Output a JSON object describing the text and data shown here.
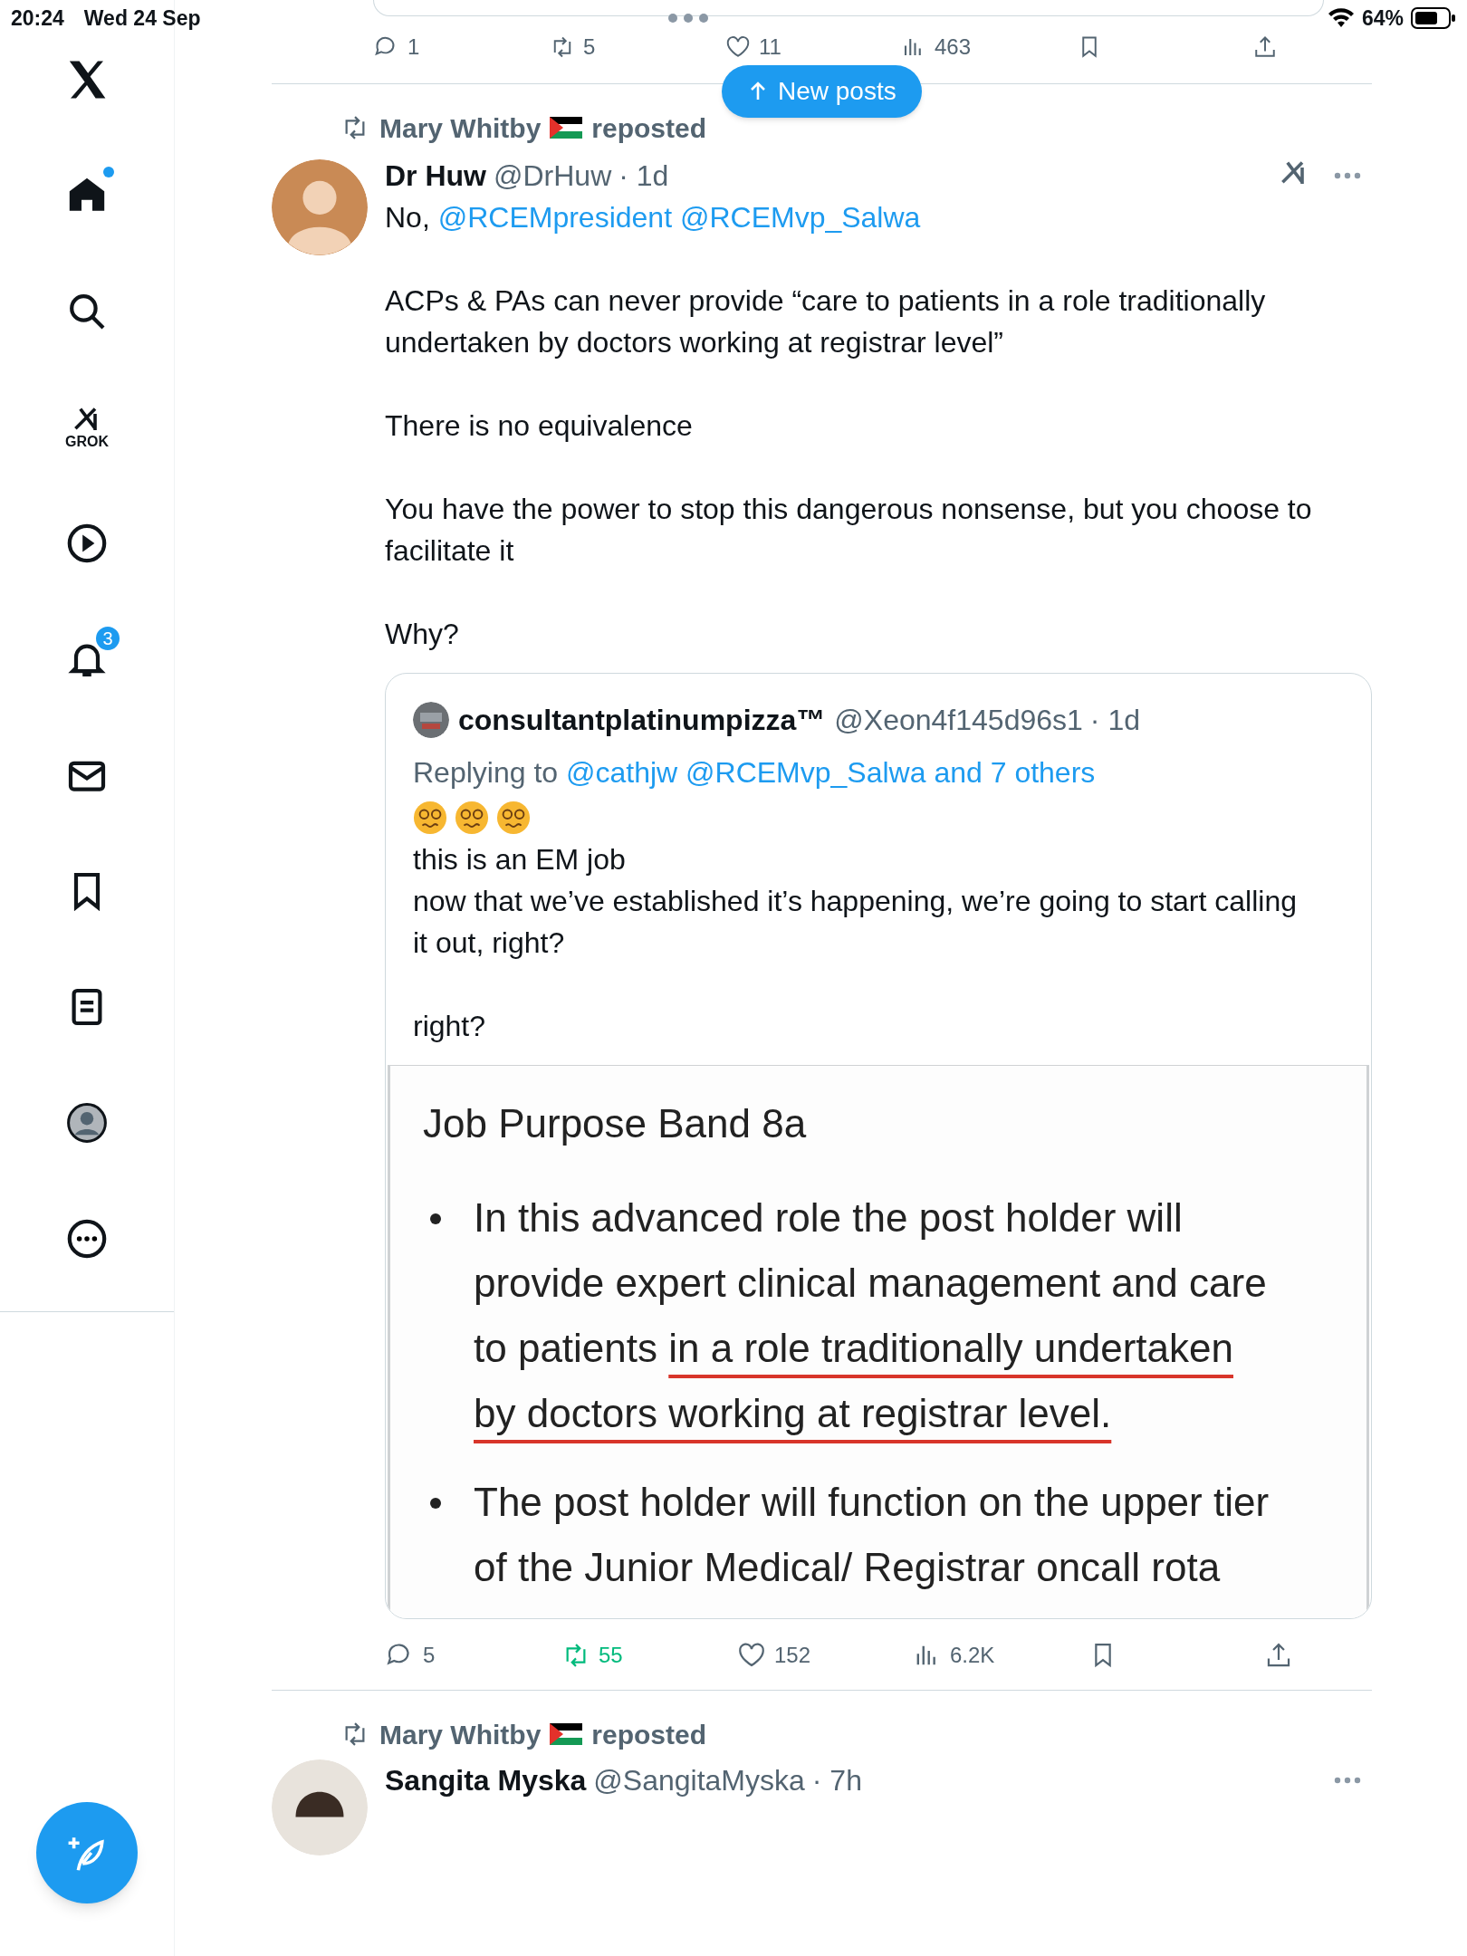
{
  "status_bar": {
    "time": "20:24",
    "date": "Wed 24 Sep",
    "battery": "64%"
  },
  "sidebar": {
    "items": [
      {
        "kind": "logo"
      },
      {
        "kind": "home",
        "selected": true,
        "has_new": true
      },
      {
        "kind": "search",
        "selected": false
      },
      {
        "kind": "grok",
        "selected": false,
        "label": "GROK"
      },
      {
        "kind": "video",
        "selected": false
      },
      {
        "kind": "notifications",
        "selected": false,
        "badge": "3"
      },
      {
        "kind": "messages",
        "selected": false
      },
      {
        "kind": "bookmarks",
        "selected": false
      },
      {
        "kind": "lists",
        "selected": false
      },
      {
        "kind": "profile",
        "selected": false
      },
      {
        "kind": "more",
        "selected": false
      }
    ]
  },
  "new_posts_button": {
    "label": "New posts"
  },
  "previous_post": {
    "actions": [
      {
        "kind": "reply",
        "count": "1",
        "active": false
      },
      {
        "kind": "repost",
        "count": "5",
        "active": false
      },
      {
        "kind": "like",
        "count": "11",
        "active": false
      },
      {
        "kind": "views",
        "count": "463",
        "active": false
      },
      {
        "kind": "bookmark",
        "active": false
      },
      {
        "kind": "share",
        "active": false
      }
    ]
  },
  "post": {
    "repost_by": "Mary Whitby",
    "repost_label": "reposted",
    "author": "Dr Huw",
    "handle": "@DrHuw",
    "time": "· 1d",
    "paragraphs": [
      [
        {
          "kind": "plain",
          "text": "No,"
        },
        {
          "kind": "mention",
          "text": "@RCEMpresident"
        },
        {
          "kind": "mention",
          "text": "@RCEMvp_Salwa"
        }
      ],
      [
        {
          "kind": "plain",
          "text": "ACPs & PAs can never provide “care to patients in a role traditionally undertaken by doctors working at registrar level”"
        }
      ],
      [
        {
          "kind": "plain",
          "text": "There is no equivalence"
        }
      ],
      [
        {
          "kind": "plain",
          "text": "You have the power to stop this dangerous nonsense, but you choose to facilitate it"
        }
      ],
      [
        {
          "kind": "plain",
          "text": "Why?"
        }
      ]
    ],
    "quote": {
      "author": "consultantplatinumpizza™",
      "handle": "@Xeon4f145d96s1",
      "time": "· 1d",
      "replying_label": "Replying to",
      "replying_to": [
        "@cathjw",
        "@RCEMvp_Salwa",
        "and 7 others"
      ],
      "paragraphs": [
        [
          "this is an EM job",
          "now that we’ve established it’s happening, we’re going to start calling it out, right?"
        ],
        [
          "right?"
        ]
      ],
      "document": {
        "title": "Job Purpose Band 8a",
        "bullets": [
          {
            "text": "In this advanced role the post holder will provide expert clinical management and care to patients",
            "underlined": "in a role traditionally undertaken by doctors working at registrar level."
          },
          {
            "text": "The post holder will function on the upper tier of the Junior Medical/ Registrar oncall rota"
          }
        ]
      }
    },
    "actions": [
      {
        "kind": "reply",
        "count": "5",
        "active": false
      },
      {
        "kind": "repost",
        "count": "55",
        "active": true
      },
      {
        "kind": "like",
        "count": "152",
        "active": false
      },
      {
        "kind": "views",
        "count": "6.2K",
        "active": false
      },
      {
        "kind": "bookmark",
        "active": false
      },
      {
        "kind": "share",
        "active": false
      }
    ]
  },
  "next_post": {
    "repost_by": "Mary Whitby",
    "repost_label": "reposted",
    "author": "Sangita Myska",
    "handle": "@SangitaMyska",
    "time": "· 7h"
  }
}
